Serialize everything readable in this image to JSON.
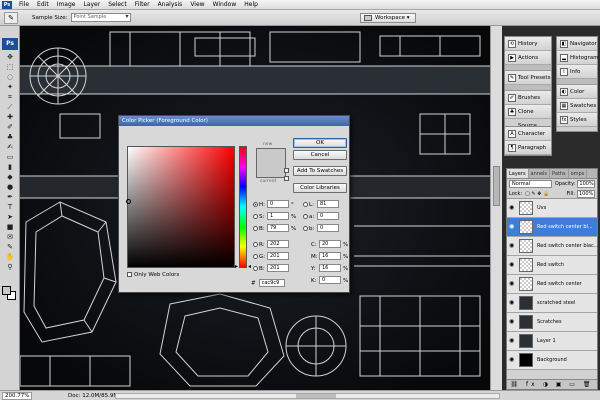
{
  "menu": [
    "File",
    "Edit",
    "Image",
    "Layer",
    "Select",
    "Filter",
    "Analysis",
    "View",
    "Window",
    "Help"
  ],
  "options_bar": {
    "sample_size_label": "Sample Size:",
    "sample_size_value": "Point Sample",
    "workspace_label": "Workspace"
  },
  "toolbox": {
    "logo": "Ps"
  },
  "status": {
    "zoom": "200.77%",
    "doc": "Doc: 12.0M/85.9M"
  },
  "panels_left": {
    "group1": [
      {
        "icon": "history-icon",
        "label": "History"
      },
      {
        "icon": "actions-icon",
        "label": "Actions"
      }
    ],
    "group2": [
      {
        "icon": "tool-presets-icon",
        "label": "Tool Presets"
      }
    ],
    "group3": [
      {
        "icon": "brushes-icon",
        "label": "Brushes"
      },
      {
        "icon": "clone-source-icon",
        "label": "Clone Source"
      }
    ],
    "group4": [
      {
        "icon": "character-icon",
        "label": "Character"
      },
      {
        "icon": "paragraph-icon",
        "label": "Paragraph"
      }
    ]
  },
  "panels_right": {
    "group1": [
      {
        "icon": "navigator-icon",
        "label": "Navigator"
      },
      {
        "icon": "histogram-icon",
        "label": "Histogram"
      },
      {
        "icon": "info-icon",
        "label": "Info"
      }
    ],
    "group2": [
      {
        "icon": "color-icon",
        "label": "Color"
      },
      {
        "icon": "swatches-icon",
        "label": "Swatches"
      },
      {
        "icon": "styles-icon",
        "label": "Styles"
      }
    ]
  },
  "layers_panel": {
    "tabs": [
      "Layers",
      "annels",
      "Paths",
      "omps"
    ],
    "blend_mode": "Normal",
    "opacity_label": "Opacity:",
    "opacity_value": "100%",
    "lock_label": "Lock:",
    "fill_label": "Fill:",
    "fill_value": "100%",
    "layers": [
      {
        "name": "Uvs",
        "thumb": "trans",
        "selected": false
      },
      {
        "name": "Red switch center bl...",
        "thumb": "trans",
        "selected": true
      },
      {
        "name": "Red switch center blac...",
        "thumb": "trans",
        "selected": false
      },
      {
        "name": "Red switch",
        "thumb": "trans",
        "selected": false
      },
      {
        "name": "Red switch center",
        "thumb": "trans",
        "selected": false
      },
      {
        "name": "scratched steel",
        "thumb": "dark",
        "selected": false
      },
      {
        "name": "Scratches",
        "thumb": "dark",
        "selected": false
      },
      {
        "name": "Layer 1",
        "thumb": "dark",
        "selected": false
      },
      {
        "name": "Background",
        "thumb": "black",
        "selected": false
      }
    ]
  },
  "color_picker": {
    "title": "Color Picker (Foreground Color)",
    "ok": "OK",
    "cancel": "Cancel",
    "add_to_swatches": "Add To Swatches",
    "color_libraries": "Color Libraries",
    "new_label": "new",
    "current_label": "current",
    "color": "#cac9c9",
    "h": "0",
    "h_unit": "°",
    "s": "1",
    "s_unit": "%",
    "b": "79",
    "b_unit": "%",
    "r": "202",
    "g": "201",
    "bb": "201",
    "l": "81",
    "a": "0",
    "lab_b": "0",
    "c": "20",
    "m": "16",
    "y": "16",
    "k": "0",
    "pct": "%",
    "hex": "cac9c9",
    "only_web_colors": "Only Web Colors",
    "hash": "#"
  }
}
